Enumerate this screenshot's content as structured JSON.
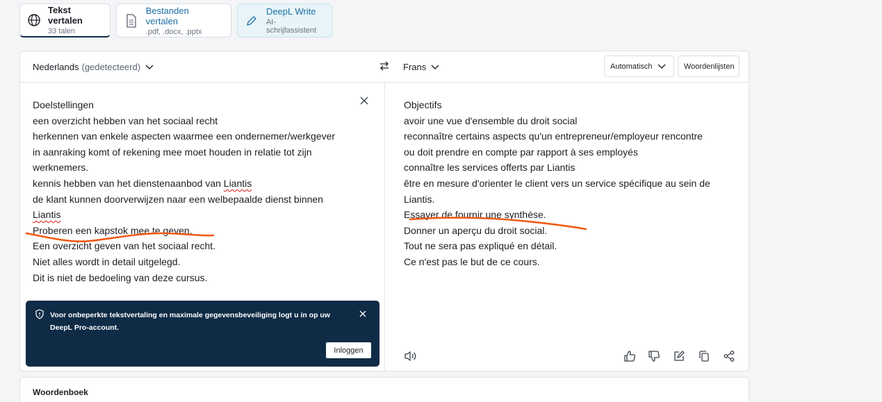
{
  "tabs": [
    {
      "title": "Tekst vertalen",
      "sub": "33 talen"
    },
    {
      "title": "Bestanden vertalen",
      "sub": ".pdf, .docx, .pptx"
    },
    {
      "title": "DeepL Write",
      "sub": "AI-schrijfassistent"
    }
  ],
  "source": {
    "language": "Nederlands",
    "detected": "(gedetecteerd)",
    "lines": [
      "Doelstellingen",
      "een overzicht hebben van het sociaal recht",
      "herkennen van enkele aspecten waarmee een ondernemer/werkgever",
      "in aanraking komt of rekening mee moet houden in relatie tot zijn",
      "werknemers.",
      "kennis hebben van het dienstenaanbod van ",
      "de klant kunnen doorverwijzen naar een welbepaalde dienst binnen",
      "Liantis",
      "Proberen een kapstok mee te geven.",
      "Een overzicht geven van het sociaal recht.",
      "Niet alles wordt in detail uitgelegd.",
      "Dit is niet de bedoeling van deze cursus."
    ],
    "liantis": "Liantis"
  },
  "target": {
    "language": "Frans",
    "formality": "Automatisch",
    "glossary": "Woordenlijsten",
    "lines": [
      "Objectifs",
      "avoir une vue d'ensemble du droit social",
      "reconnaître certains aspects qu'un entrepreneur/employeur rencontre",
      "ou doit prendre en compte par rapport à ses employés",
      "connaître les services offerts par Liantis",
      "être en mesure d'orienter le client vers un service spécifique au sein de",
      "Liantis.",
      "Essayer de fournir une synthèse.",
      "Donner un aperçu du droit social.",
      "Tout ne sera pas expliqué en détail.",
      "Ce n'est pas le but de ce cours."
    ]
  },
  "toast": {
    "message": "Voor onbeperkte tekstvertaling en maximale gegevensbeveiliging logt u in op uw DeepL Pro-account.",
    "login": "Inloggen"
  },
  "dictionary": {
    "title": "Woordenboek"
  },
  "colors": {
    "annotation": "#f05a14",
    "dark": "#0f2b46"
  }
}
